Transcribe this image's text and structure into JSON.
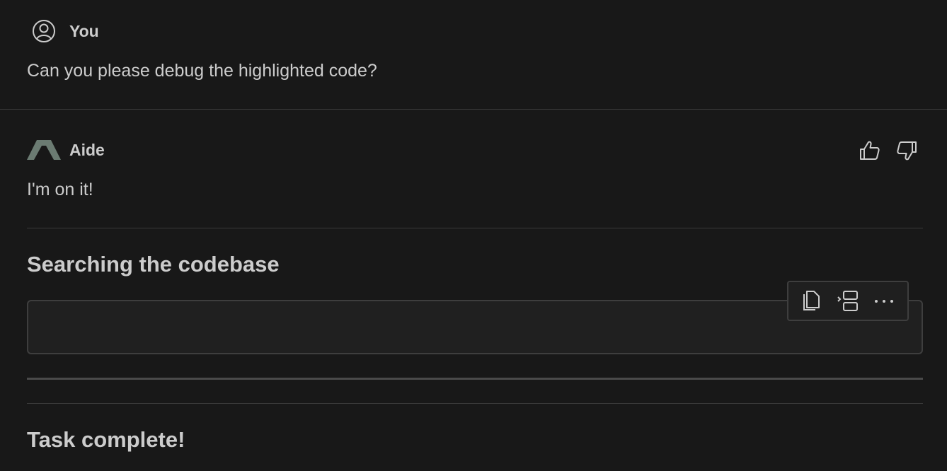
{
  "user_message": {
    "author": "You",
    "text": "Can you please debug the highlighted code?",
    "avatar_icon": "account-circle-icon"
  },
  "assistant_message": {
    "author": "Aide",
    "text": "I'm on it!",
    "logo_icon": "aide-logo-icon",
    "feedback": {
      "thumbs_up_icon": "thumbs-up-icon",
      "thumbs_down_icon": "thumbs-down-icon"
    }
  },
  "sections": [
    {
      "heading": "Searching the codebase"
    },
    {
      "heading": "Task complete!"
    }
  ],
  "code_toolbar": {
    "buttons": [
      "copy-icon",
      "insert-at-cursor-icon",
      "more-icon"
    ]
  },
  "colors": {
    "background": "#181818",
    "text": "#cccccc",
    "border": "#3a3a3a",
    "logo": "#6b7b72"
  }
}
